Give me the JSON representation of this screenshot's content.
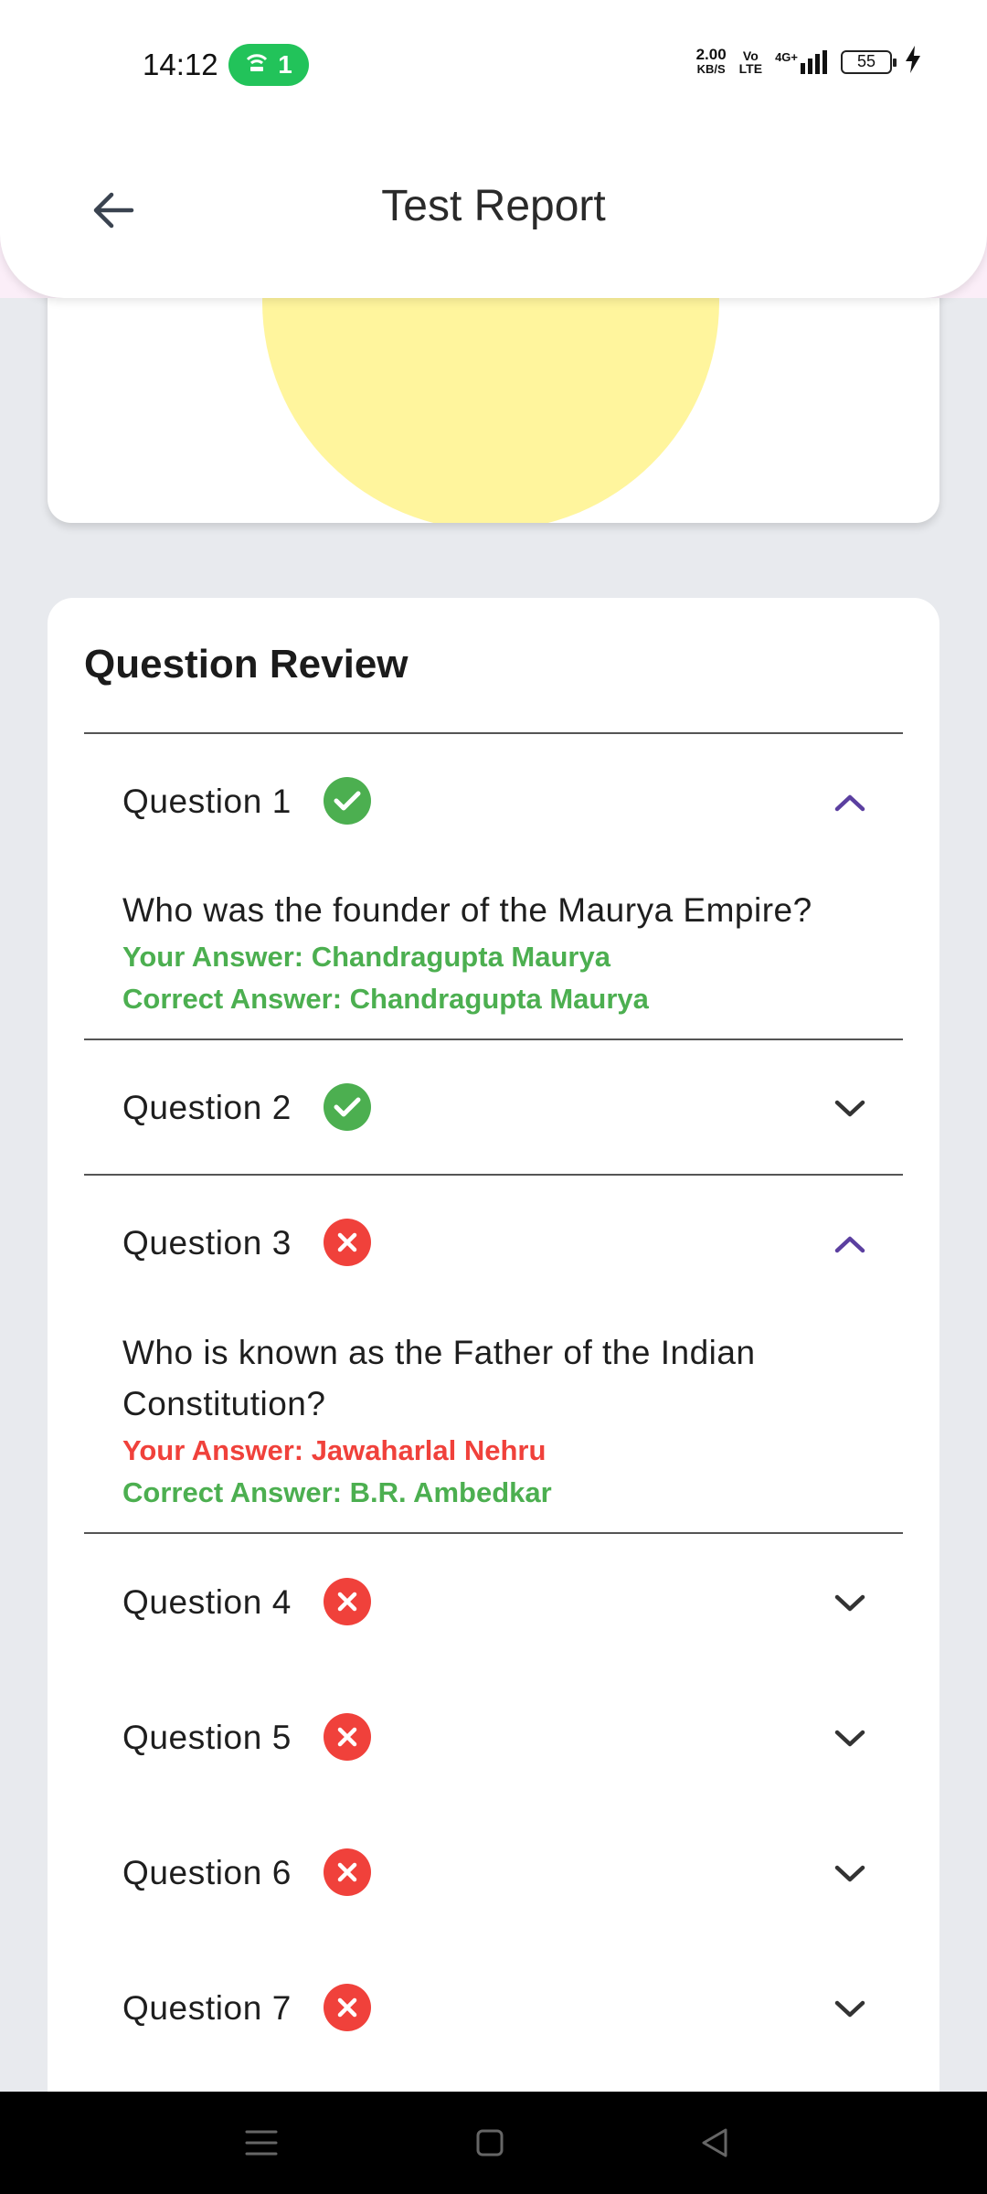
{
  "status_bar": {
    "time": "14:12",
    "hotspot_count": "1",
    "speed_value": "2.00",
    "speed_unit": "KB/S",
    "volte_top": "Vo",
    "volte_bottom": "LTE",
    "network": "4G+",
    "battery": "55"
  },
  "app_bar": {
    "title": "Test Report"
  },
  "review": {
    "title": "Question Review",
    "questions": [
      {
        "label": "Question 1",
        "status": "correct",
        "expanded": true,
        "text": "Who was the founder of the Maurya Empire?",
        "your_answer": "Your Answer: Chandragupta Maurya",
        "correct_answer": "Correct Answer: Chandragupta Maurya"
      },
      {
        "label": "Question 2",
        "status": "correct",
        "expanded": false
      },
      {
        "label": "Question 3",
        "status": "incorrect",
        "expanded": true,
        "text": "Who is known as the Father of the Indian Constitution?",
        "your_answer": "Your Answer: Jawaharlal Nehru",
        "correct_answer": "Correct Answer: B.R. Ambedkar"
      },
      {
        "label": "Question 4",
        "status": "incorrect",
        "expanded": false
      },
      {
        "label": "Question 5",
        "status": "incorrect",
        "expanded": false
      },
      {
        "label": "Question 6",
        "status": "incorrect",
        "expanded": false
      },
      {
        "label": "Question 7",
        "status": "incorrect",
        "expanded": false
      }
    ]
  },
  "colors": {
    "correct": "#4caf50",
    "incorrect": "#f0413b",
    "chevron_expanded": "#5b3fa0",
    "chevron_collapsed": "#333333",
    "pie_slice": "#fff59d"
  }
}
